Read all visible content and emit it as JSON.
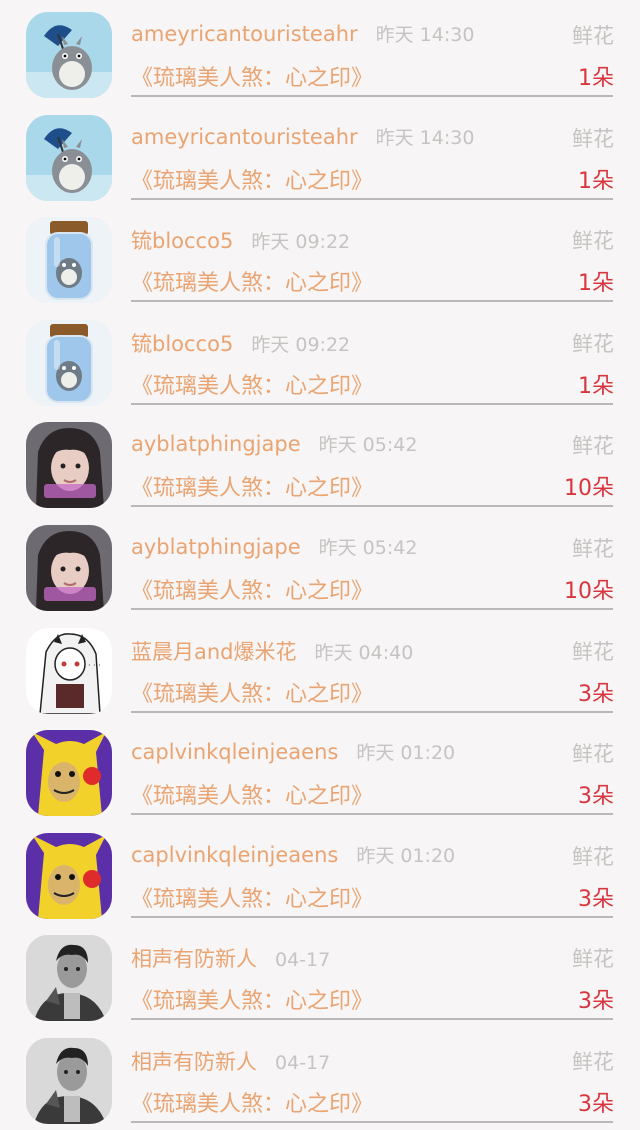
{
  "gift_label": "鲜花",
  "items": [
    {
      "name": "ameyricantouristeahr",
      "time": "昨天 14:30",
      "book": "《琉璃美人煞：心之印》",
      "gift": "鲜花",
      "count": "1朵",
      "avatar": "totoro-umbrella-avatar"
    },
    {
      "name": "ameyricantouristeahr",
      "time": "昨天 14:30",
      "book": "《琉璃美人煞：心之印》",
      "gift": "鲜花",
      "count": "1朵",
      "avatar": "totoro-umbrella-avatar"
    },
    {
      "name": "锍blocco5",
      "time": "昨天 09:22",
      "book": "《琉璃美人煞：心之印》",
      "gift": "鲜花",
      "count": "1朵",
      "avatar": "totoro-bottle-avatar"
    },
    {
      "name": "锍blocco5",
      "time": "昨天 09:22",
      "book": "《琉璃美人煞：心之印》",
      "gift": "鲜花",
      "count": "1朵",
      "avatar": "totoro-bottle-avatar"
    },
    {
      "name": "ayblatphingjape",
      "time": "昨天 05:42",
      "book": "《琉璃美人煞：心之印》",
      "gift": "鲜花",
      "count": "10朵",
      "avatar": "girl-photo-avatar"
    },
    {
      "name": "ayblatphingjape",
      "time": "昨天 05:42",
      "book": "《琉璃美人煞：心之印》",
      "gift": "鲜花",
      "count": "10朵",
      "avatar": "girl-photo-avatar"
    },
    {
      "name": "蓝晨月and爆米花",
      "time": "昨天 04:40",
      "book": "《琉璃美人煞：心之印》",
      "gift": "鲜花",
      "count": "3朵",
      "avatar": "anime-girl-avatar"
    },
    {
      "name": "caplvinkqleinjeaens",
      "time": "昨天 01:20",
      "book": "《琉璃美人煞：心之印》",
      "gift": "鲜花",
      "count": "3朵",
      "avatar": "pikachu-meme-avatar"
    },
    {
      "name": "caplvinkqleinjeaens",
      "time": "昨天 01:20",
      "book": "《琉璃美人煞：心之印》",
      "gift": "鲜花",
      "count": "3朵",
      "avatar": "pikachu-meme-avatar"
    },
    {
      "name": "相声有防新人",
      "time": "04-17",
      "book": "《琉璃美人煞：心之印》",
      "gift": "鲜花",
      "count": "3朵",
      "avatar": "man-portrait-avatar"
    },
    {
      "name": "相声有防新人",
      "time": "04-17",
      "book": "《琉璃美人煞：心之印》",
      "gift": "鲜花",
      "count": "3朵",
      "avatar": "man-portrait-avatar"
    }
  ]
}
